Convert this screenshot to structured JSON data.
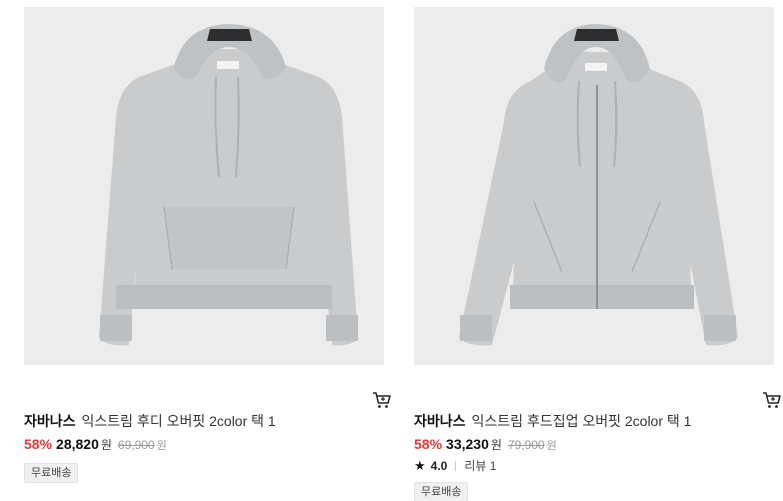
{
  "products": [
    {
      "brand": "자바나스",
      "name": "익스트림 후디 오버핏 2color 택 1",
      "discount": "58%",
      "price": "28,820",
      "currency": "원",
      "original_price": "69,900",
      "original_currency": "원",
      "badge": "무료배송",
      "image_desc": "gray pullover hoodie",
      "colors": {
        "fabric": "#c9cbcd",
        "background": "#ececec"
      }
    },
    {
      "brand": "자바나스",
      "name": "익스트림 후드집업 오버핏 2color 택 1",
      "discount": "58%",
      "price": "33,230",
      "currency": "원",
      "original_price": "79,900",
      "original_currency": "원",
      "rating": "4.0",
      "review": "리뷰 1",
      "badge": "무료배송",
      "image_desc": "gray zip-up hoodie",
      "colors": {
        "fabric": "#c9cbcd",
        "background": "#ececec"
      }
    }
  ],
  "colors": {
    "discount": "#e53935"
  },
  "icons": {
    "cart": "cart-icon",
    "star": "star-icon"
  }
}
